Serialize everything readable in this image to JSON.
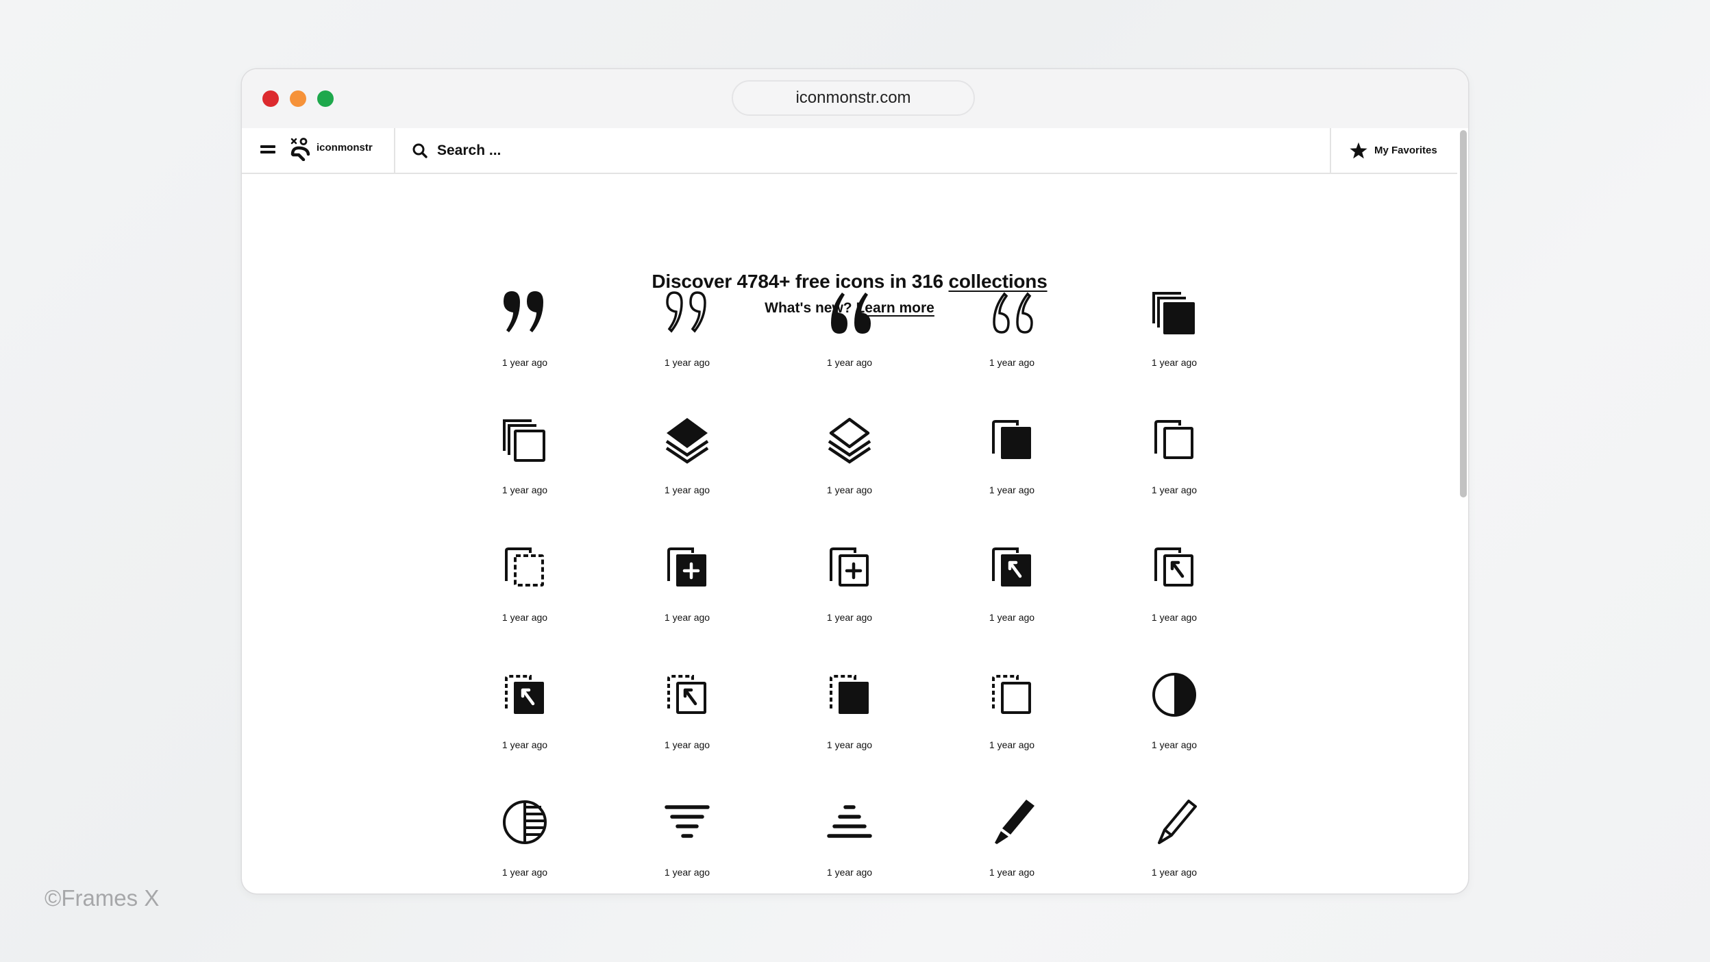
{
  "browser": {
    "url": "iconmonstr.com",
    "traffic_lights": {
      "close": "#dc2a2e",
      "minimize": "#f69239",
      "maximize": "#1ea84c"
    }
  },
  "navbar": {
    "menu_icon": "hamburger-icon",
    "logo_text": "iconmonstr",
    "search_placeholder": "Search ...",
    "favorites_label": "My Favorites",
    "favorites_icon": "star-icon"
  },
  "hero": {
    "headline_prefix": "Discover 4784+ free icons in 316 ",
    "headline_link": "collections",
    "subline_prefix": "What's new? ",
    "subline_link": "Learn more"
  },
  "icons": [
    {
      "icon": "quote-right-filled",
      "label": "1 year ago"
    },
    {
      "icon": "quote-right-outline",
      "label": "1 year ago"
    },
    {
      "icon": "quote-left-filled",
      "label": "1 year ago"
    },
    {
      "icon": "quote-left-outline",
      "label": "1 year ago"
    },
    {
      "icon": "stack-filled",
      "label": "1 year ago"
    },
    {
      "icon": "stack-outline",
      "label": "1 year ago"
    },
    {
      "icon": "layers-filled",
      "label": "1 year ago"
    },
    {
      "icon": "layers-outline",
      "label": "1 year ago"
    },
    {
      "icon": "copy-filled",
      "label": "1 year ago"
    },
    {
      "icon": "copy-outline",
      "label": "1 year ago"
    },
    {
      "icon": "copy-dashed",
      "label": "1 year ago"
    },
    {
      "icon": "copy-add-filled",
      "label": "1 year ago"
    },
    {
      "icon": "copy-add-outline",
      "label": "1 year ago"
    },
    {
      "icon": "copy-arrow-filled",
      "label": "1 year ago"
    },
    {
      "icon": "copy-arrow-outline",
      "label": "1 year ago"
    },
    {
      "icon": "dashed-copy-arrow-filled",
      "label": "1 year ago"
    },
    {
      "icon": "dashed-copy-arrow-outline",
      "label": "1 year ago"
    },
    {
      "icon": "dashed-copy-filled",
      "label": "1 year ago"
    },
    {
      "icon": "dashed-copy-outline",
      "label": "1 year ago"
    },
    {
      "icon": "contrast-half",
      "label": "1 year ago"
    },
    {
      "icon": "contrast-striped",
      "label": "1 year ago"
    },
    {
      "icon": "filter-lines",
      "label": "1 year ago"
    },
    {
      "icon": "pyramid-lines",
      "label": "1 year ago"
    },
    {
      "icon": "pencil-filled",
      "label": "1 year ago"
    },
    {
      "icon": "pencil-outline",
      "label": "1 year ago"
    }
  ],
  "watermark": "©Frames X"
}
